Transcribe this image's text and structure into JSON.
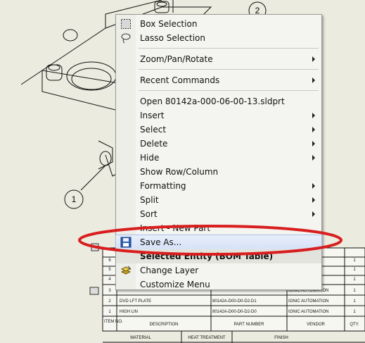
{
  "menu": {
    "items": [
      {
        "label": "Box Selection",
        "icon": "box-selection-icon"
      },
      {
        "label": "Lasso Selection",
        "icon": "lasso-selection-icon"
      },
      {
        "label": "Zoom/Pan/Rotate",
        "submenu": true
      },
      {
        "label": "Recent Commands",
        "submenu": true
      },
      {
        "label": "Open 80142a-000-06-00-13.sldprt"
      },
      {
        "label": "Insert",
        "submenu": true
      },
      {
        "label": "Select",
        "submenu": true
      },
      {
        "label": "Delete",
        "submenu": true
      },
      {
        "label": "Hide",
        "submenu": true
      },
      {
        "label": "Show Row/Column"
      },
      {
        "label": "Formatting",
        "submenu": true
      },
      {
        "label": "Split",
        "submenu": true
      },
      {
        "label": "Sort",
        "submenu": true
      },
      {
        "label": "Insert - New Part"
      },
      {
        "label": "Save As...",
        "icon": "save-icon",
        "highlighted": true
      },
      {
        "label": "Selected Entity (BOM Table)",
        "header": true
      },
      {
        "label": "Change Layer",
        "icon": "layers-icon"
      },
      {
        "label": "Customize Menu"
      }
    ]
  },
  "drawing": {
    "balloon_1": "1",
    "balloon_2": "2",
    "bom_rows": [
      {
        "item": "6",
        "desc": "",
        "part": "",
        "vendor": "",
        "qty": "1"
      },
      {
        "item": "5",
        "desc": "",
        "part": "",
        "vendor": "",
        "qty": "1"
      },
      {
        "item": "4",
        "desc": "",
        "part": "",
        "vendor": "",
        "qty": "1"
      },
      {
        "item": "3",
        "desc": "",
        "part": "",
        "vendor": "IONIC AUTOMATION",
        "qty": "1"
      },
      {
        "item": "2",
        "desc": "DVD LFT PLATE",
        "part": "80142A-D00-D0-D2-D1",
        "vendor": "IONIC AUTOMATION",
        "qty": "1"
      },
      {
        "item": "1",
        "desc": "HIGH LIN",
        "part": "80142A-D00-D0-D2-D0",
        "vendor": "IONIC AUTOMATION",
        "qty": "1"
      }
    ],
    "bom_header": {
      "item": "ITEM NO.",
      "desc": "DESCRIPTION",
      "part": "PART NUMBER",
      "vendor": "VENDOR",
      "qty": "QTY."
    },
    "title_header": {
      "material": "MATERIAL",
      "heat": "HEAT TREATMENT",
      "finish": "FINISH"
    }
  },
  "colors": {
    "annotation": "#d81e1e",
    "highlight": "#d6e2f7",
    "menu_bg": "#f4f4f1",
    "sheet_bg": "#ecebdf"
  }
}
